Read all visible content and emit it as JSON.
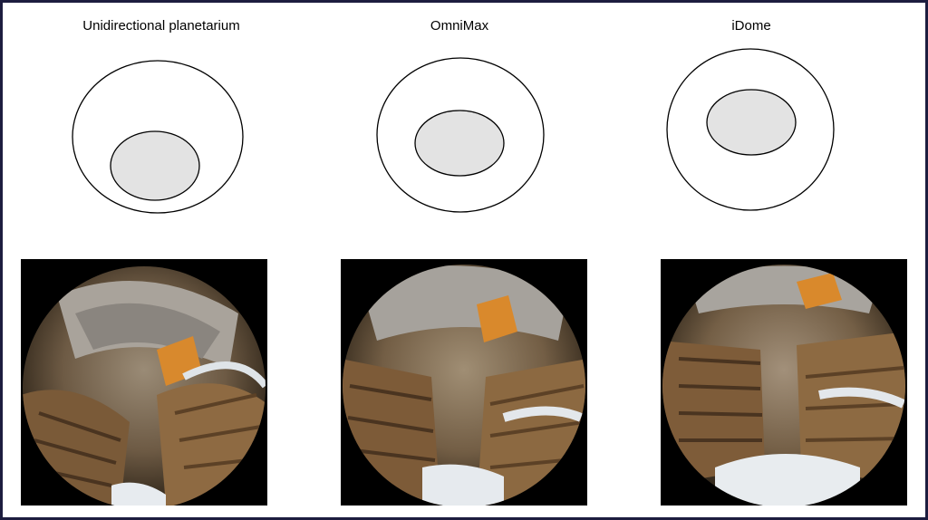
{
  "columns": [
    {
      "label": "Unidirectional planetarium",
      "kind": "unidirectional"
    },
    {
      "label": "OmniMax",
      "kind": "omnimax"
    },
    {
      "label": "iDome",
      "kind": "idome"
    }
  ],
  "colors": {
    "border": "#1d1d3f",
    "dome_outline": "#000000",
    "view_area": "#e3e3e3",
    "photo_bg": "#000000"
  }
}
